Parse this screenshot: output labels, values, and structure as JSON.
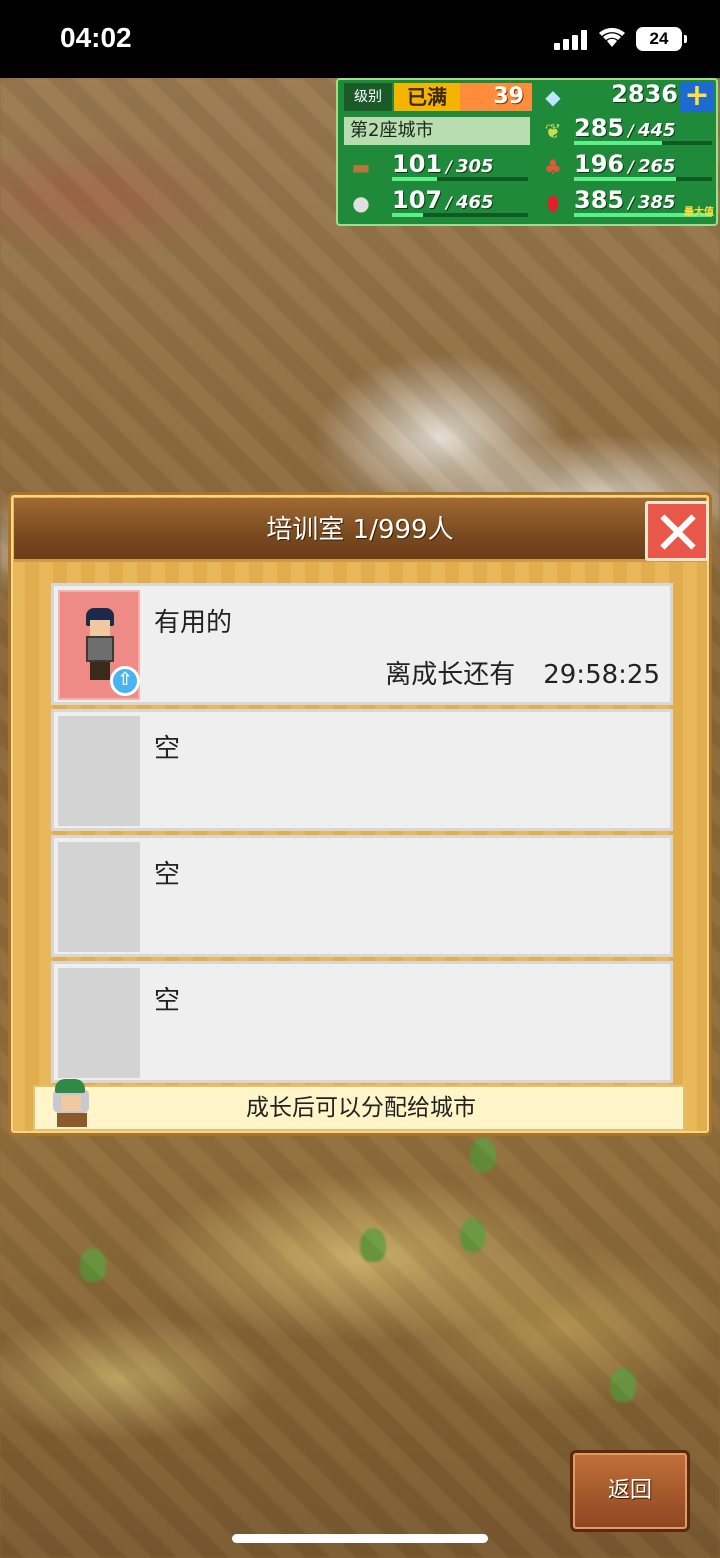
{
  "status_bar": {
    "time": "04:02",
    "battery": "24"
  },
  "hud": {
    "level_label": "级别",
    "level_status": "已满",
    "level_value": "39",
    "gems": "2836",
    "city_name": "第2座城市",
    "resources": {
      "wood": {
        "current": "101",
        "max": "305",
        "fill": 0.33
      },
      "crop": {
        "current": "285",
        "max": "445",
        "fill": 0.64
      },
      "food": {
        "current": "196",
        "max": "265",
        "fill": 0.74
      },
      "stone": {
        "current": "107",
        "max": "465",
        "fill": 0.23
      },
      "ruby": {
        "current": "385",
        "max": "385",
        "fill": 1.0,
        "tag": "最大值"
      }
    },
    "icons": {
      "gem": "diamond-icon",
      "plus": "plus-icon",
      "wood": "log-icon",
      "crop": "wheat-icon",
      "food": "food-icon",
      "stone": "stone-icon",
      "ruby": "ruby-icon"
    }
  },
  "panel": {
    "title": "培训室 1/999人",
    "slots": [
      {
        "name": "有用的",
        "growth_label": "离成长还有",
        "growth_time": "29:58:25"
      },
      {
        "name": "空"
      },
      {
        "name": "空"
      },
      {
        "name": "空"
      }
    ],
    "footer_tip": "成长后可以分配给城市"
  },
  "back_button": "返回",
  "colors": {
    "hud_green": "#1f8a3a",
    "panel_wood": "#e9b85a",
    "close_red": "#e8574a",
    "portrait_pink": "#ef8b87",
    "back_brown": "#a05a2c"
  }
}
